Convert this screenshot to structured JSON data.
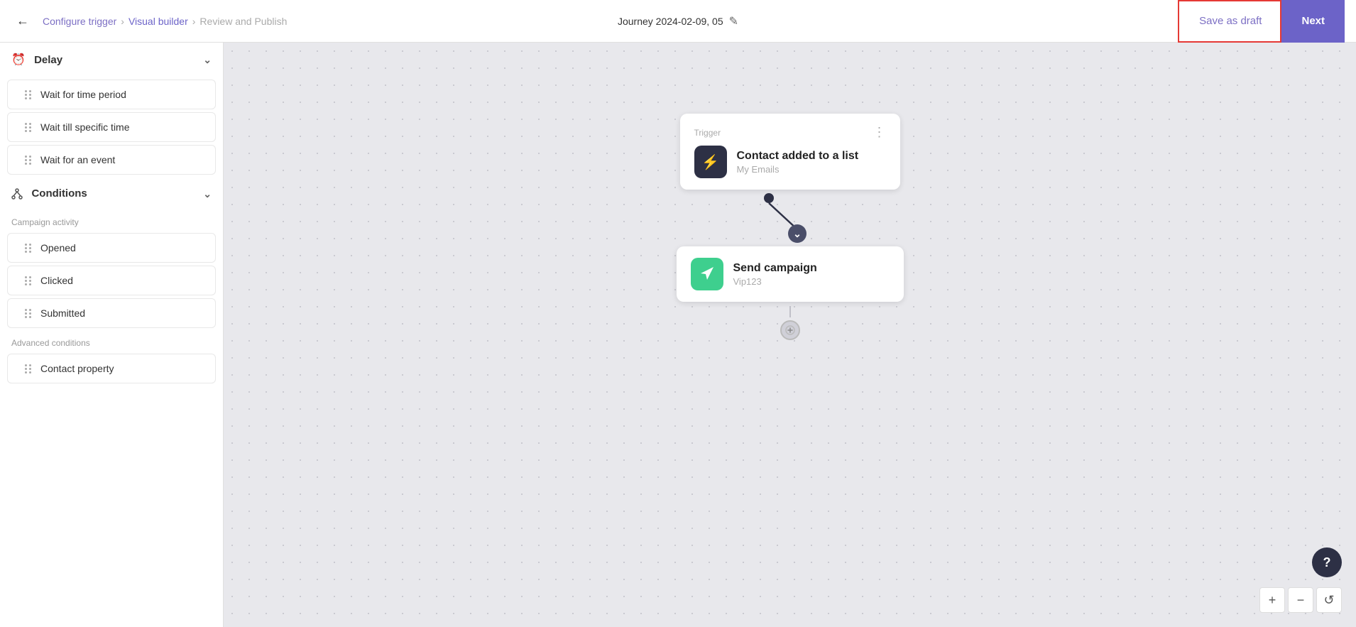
{
  "header": {
    "back_icon": "←",
    "breadcrumb": [
      {
        "label": "Configure trigger",
        "active": false
      },
      {
        "label": "Visual builder",
        "active": true
      },
      {
        "label": "Review and Publish",
        "active": false
      }
    ],
    "journey_name": "Journey 2024-02-09, 05",
    "edit_icon": "✎",
    "save_draft_label": "Save as draft",
    "next_label": "Next"
  },
  "sidebar": {
    "sections": [
      {
        "id": "delay",
        "icon": "⏱",
        "label": "Delay",
        "expanded": true,
        "categories": [],
        "items": [
          {
            "id": "wait-time-period",
            "label": "Wait for time period"
          },
          {
            "id": "wait-specific-time",
            "label": "Wait till specific time"
          },
          {
            "id": "wait-event",
            "label": "Wait for an event"
          }
        ]
      },
      {
        "id": "conditions",
        "icon": "⎇",
        "label": "Conditions",
        "expanded": true,
        "categories": [
          {
            "label": "Campaign activity",
            "items": [
              {
                "id": "opened",
                "label": "Opened"
              },
              {
                "id": "clicked",
                "label": "Clicked"
              },
              {
                "id": "submitted",
                "label": "Submitted"
              }
            ]
          },
          {
            "label": "Advanced conditions",
            "items": [
              {
                "id": "contact-property",
                "label": "Contact property"
              }
            ]
          }
        ],
        "items": []
      }
    ]
  },
  "canvas": {
    "trigger_node": {
      "label": "Trigger",
      "title": "Contact added to a list",
      "subtitle": "My Emails",
      "icon": "⚡"
    },
    "send_node": {
      "title": "Send campaign",
      "subtitle": "Vip123",
      "icon": "📢"
    }
  },
  "controls": {
    "zoom_in": "+",
    "zoom_out": "−",
    "reset": "↺",
    "help": "?"
  }
}
